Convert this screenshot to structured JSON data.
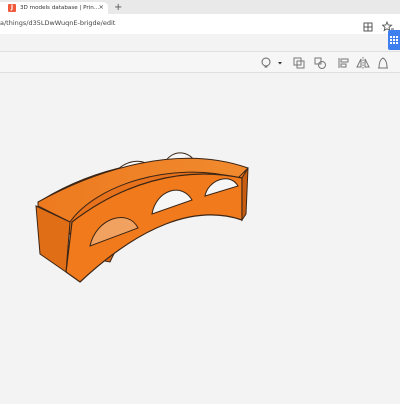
{
  "tab": {
    "favicon_letter": "J",
    "title": "3D models database | Printables.com",
    "close": "×"
  },
  "newtab": "+",
  "url": "a/things/d35LDwWuqnE-brigde/edit",
  "colors": {
    "bridge": "#f07a1c",
    "bridge_dark": "#c2560d",
    "outline": "#3a2516",
    "accent": "#3d7ff0"
  },
  "icons": [
    "reader-icon",
    "star-icon",
    "grid-icon",
    "lightbulb-icon",
    "group-icon",
    "ungroup-icon",
    "align-icon",
    "mirror-icon",
    "workplane-icon"
  ]
}
